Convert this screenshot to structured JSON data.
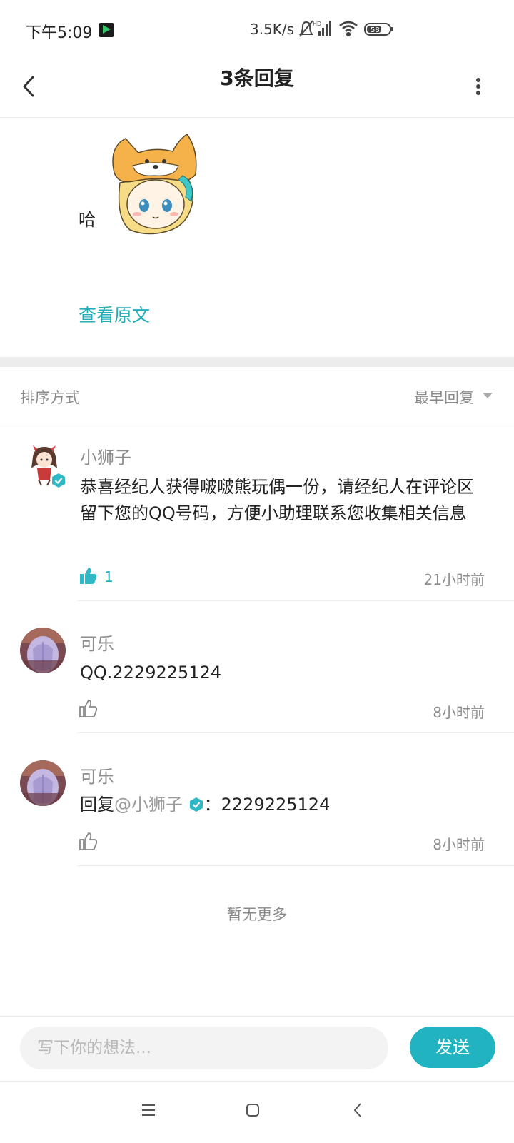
{
  "status_bar": {
    "time": "下午5:09",
    "net_speed": "3.5K/s",
    "battery": "58"
  },
  "header": {
    "title": "3条回复"
  },
  "original_post": {
    "text": "哈",
    "view_original_label": "查看原文"
  },
  "sort": {
    "label": "排序方式",
    "value": "最早回复"
  },
  "comments": [
    {
      "username": "小狮子",
      "verified": true,
      "text": "恭喜经纪人获得啵啵熊玩偶一份，请经纪人在评论区留下您的QQ号码，方便小助理联系您收集相关信息",
      "likes": "1",
      "time": "21小时前"
    },
    {
      "username": "可乐",
      "text": "QQ.2229225124",
      "time": "8小时前"
    },
    {
      "username": "可乐",
      "reply_prefix": "回复",
      "mention": "@小狮子",
      "reply_text": "：2229225124",
      "time": "8小时前"
    }
  ],
  "no_more": "暂无更多",
  "composer": {
    "placeholder": "写下你的想法...",
    "send_label": "发送"
  },
  "colors": {
    "accent": "#21b4c0",
    "link": "#21aeb8",
    "muted": "#8d8d8d"
  }
}
